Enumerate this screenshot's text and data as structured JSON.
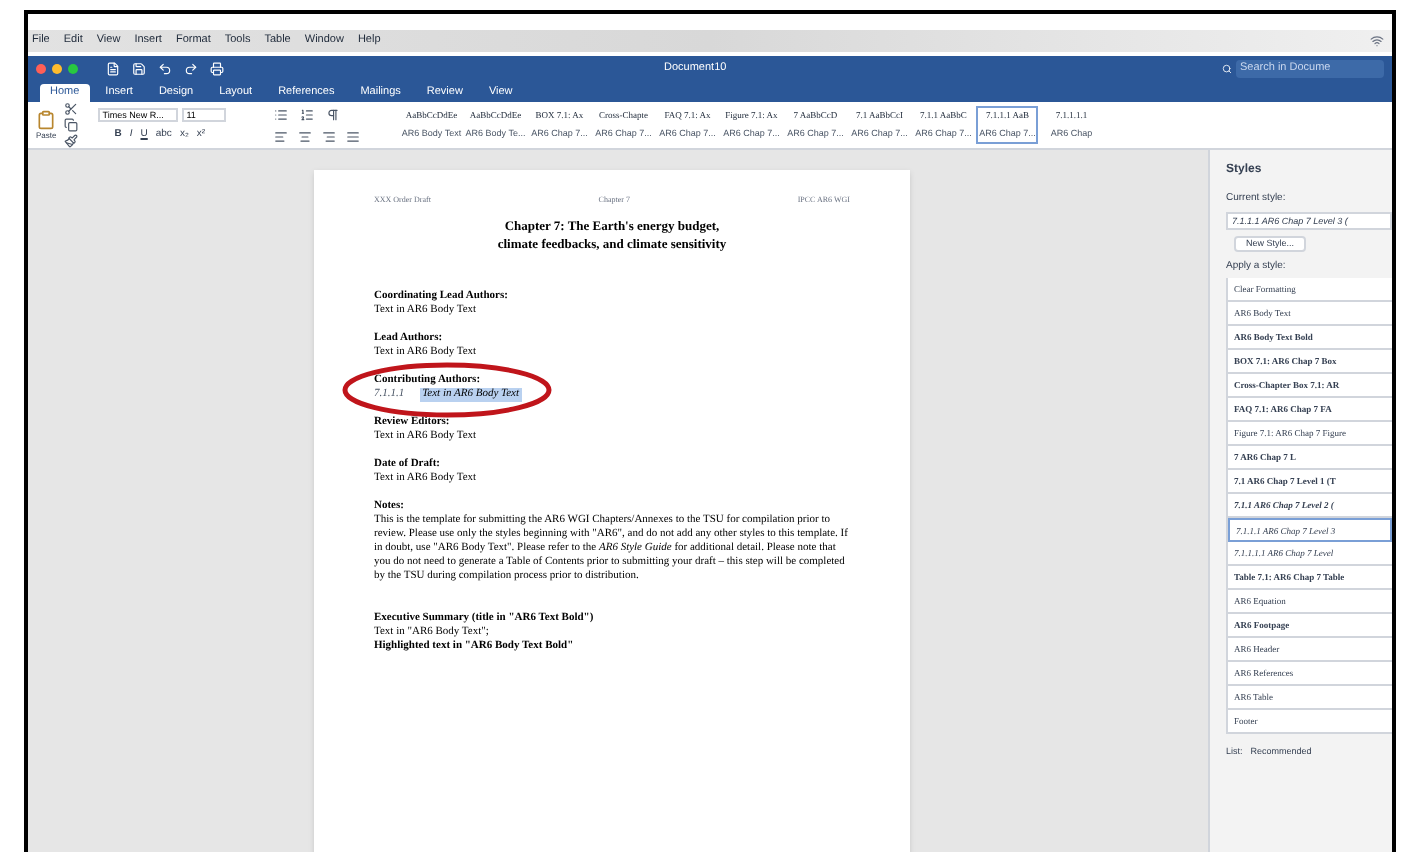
{
  "menu_bar": [
    "File",
    "Edit",
    "View",
    "Insert",
    "Format",
    "Tools",
    "Table",
    "Window",
    "Help"
  ],
  "window": {
    "title": "Document10",
    "search": {
      "placeholder": "Search in Docume"
    }
  },
  "tabs": [
    {
      "label": "Home",
      "selected": true
    },
    {
      "label": "Insert",
      "selected": false
    },
    {
      "label": "Design",
      "selected": false
    },
    {
      "label": "Layout",
      "selected": false
    },
    {
      "label": "References",
      "selected": false
    },
    {
      "label": "Mailings",
      "selected": false
    },
    {
      "label": "Review",
      "selected": false
    },
    {
      "label": "View",
      "selected": false
    }
  ],
  "ribbon": {
    "paste_label": "Paste",
    "font": "Times New R...",
    "size": "11",
    "format_buttons": [
      "B",
      "I",
      "U",
      "abc",
      "x₂",
      "x²"
    ],
    "styles_gallery": [
      {
        "preview": "AaBbCcDdEe",
        "name": "AR6 Body Text",
        "selected": false
      },
      {
        "preview": "AaBbCcDdEe",
        "name": "AR6 Body Te...",
        "selected": false
      },
      {
        "preview": "BOX 7.1: Ax",
        "name": "AR6 Chap 7...",
        "selected": false
      },
      {
        "preview": "Cross-Chapte",
        "name": "AR6 Chap 7...",
        "selected": false
      },
      {
        "preview": "FAQ 7.1: Ax",
        "name": "AR6 Chap 7...",
        "selected": false
      },
      {
        "preview": "Figure 7.1: Ax",
        "name": "AR6 Chap 7...",
        "selected": false
      },
      {
        "preview": "7 AaBbCcD",
        "name": "AR6 Chap 7...",
        "selected": false
      },
      {
        "preview": "7.1 AaBbCcI",
        "name": "AR6 Chap 7...",
        "selected": false
      },
      {
        "preview": "7.1.1 AaBbC",
        "name": "AR6 Chap 7...",
        "selected": false
      },
      {
        "preview": "7.1.1.1 AaB",
        "name": "AR6 Chap 7...",
        "selected": true
      },
      {
        "preview": "7.1.1.1.1",
        "name": "AR6 Chap",
        "selected": false
      }
    ]
  },
  "document": {
    "header": [
      "XXX Order Draft",
      "Chapter 7",
      "IPCC AR6 WGI"
    ],
    "title": [
      "Chapter 7: The Earth's energy budget,",
      "climate feedbacks, and climate sensitivity"
    ],
    "sections": [
      {
        "heading": "Coordinating Lead Authors:",
        "body": "Text in AR6 Body Text",
        "highlighted": false
      },
      {
        "heading": "Lead Authors:",
        "body": "Text in AR6 Body Text",
        "highlighted": false
      },
      {
        "heading": "Contributing Authors:",
        "number": "7.1.1.1",
        "body": "Text in AR6 Body Text",
        "highlighted": true
      },
      {
        "heading": "Review Editors:",
        "body": "Text in AR6 Body Text",
        "highlighted": false
      },
      {
        "heading": "Date of Draft:",
        "body": "Text in AR6 Body Text",
        "highlighted": false
      },
      {
        "heading": "Notes:",
        "body": "This is the template for submitting the AR6 WGI Chapters/Annexes to the TSU for compilation prior to review. Please use only the styles beginning with \"AR6\", and do not add any other styles to this template. If in doubt, use \"AR6 Body Text\". Please refer to the *AR6 Style Guide* for additional detail. Please note that you do not need to generate a Table of Contents prior to submitting your draft – this step will be completed by the TSU during compilation process prior to distribution.",
        "highlighted": false
      }
    ],
    "summary": [
      {
        "text": "Executive Summary (title in \"AR6 Text Bold\")",
        "bold": true
      },
      {
        "text": "Text in \"AR6 Body Text\";",
        "bold": false
      },
      {
        "text": "Highlighted text in \"AR6 Body Text Bold\"",
        "bold": true
      }
    ]
  },
  "styles_pane": {
    "title": "Styles",
    "current_label": "Current style:",
    "current_value": "7.1.1.1 AR6 Chap 7 Level 3 (",
    "new_style": "New Style...",
    "apply_label": "Apply a style:",
    "items": [
      {
        "label": "Clear Formatting",
        "bold": false,
        "italic": false,
        "selected": false
      },
      {
        "label": "AR6 Body Text",
        "bold": false,
        "italic": false,
        "selected": false
      },
      {
        "label": "AR6 Body Text Bold",
        "bold": true,
        "italic": false,
        "selected": false
      },
      {
        "label": "BOX 7.1: AR6 Chap 7 Box",
        "bold": true,
        "italic": false,
        "selected": false
      },
      {
        "label": "Cross-Chapter Box 7.1: AR",
        "bold": true,
        "italic": false,
        "selected": false
      },
      {
        "label": "FAQ 7.1: AR6 Chap 7 FA",
        "bold": true,
        "italic": false,
        "selected": false
      },
      {
        "label": "Figure 7.1: AR6 Chap 7 Figure",
        "bold": false,
        "italic": false,
        "selected": false
      },
      {
        "label": "7 AR6 Chap 7 L",
        "bold": true,
        "italic": false,
        "selected": false
      },
      {
        "label": "7.1 AR6 Chap 7 Level 1 (T",
        "bold": true,
        "italic": false,
        "selected": false
      },
      {
        "label": "7.1.1 AR6 Chap 7 Level 2 (",
        "bold": true,
        "italic": true,
        "selected": false
      },
      {
        "label": "7.1.1.1 AR6 Chap 7 Level 3",
        "bold": false,
        "italic": true,
        "selected": true
      },
      {
        "label": "7.1.1.1.1 AR6 Chap 7 Level",
        "bold": false,
        "italic": true,
        "selected": false
      },
      {
        "label": "Table 7.1: AR6 Chap 7 Table",
        "bold": true,
        "italic": false,
        "selected": false
      },
      {
        "label": "AR6 Equation",
        "bold": false,
        "italic": false,
        "selected": false
      },
      {
        "label": "AR6 Footpage",
        "bold": true,
        "italic": false,
        "selected": false
      },
      {
        "label": "AR6 Header",
        "bold": false,
        "italic": false,
        "selected": false
      },
      {
        "label": "AR6 References",
        "bold": false,
        "italic": false,
        "selected": false
      },
      {
        "label": "AR6 Table",
        "bold": false,
        "italic": false,
        "selected": false
      },
      {
        "label": "Footer",
        "bold": false,
        "italic": false,
        "selected": false
      }
    ],
    "list_label": "List:",
    "list_value": "Recommended"
  }
}
